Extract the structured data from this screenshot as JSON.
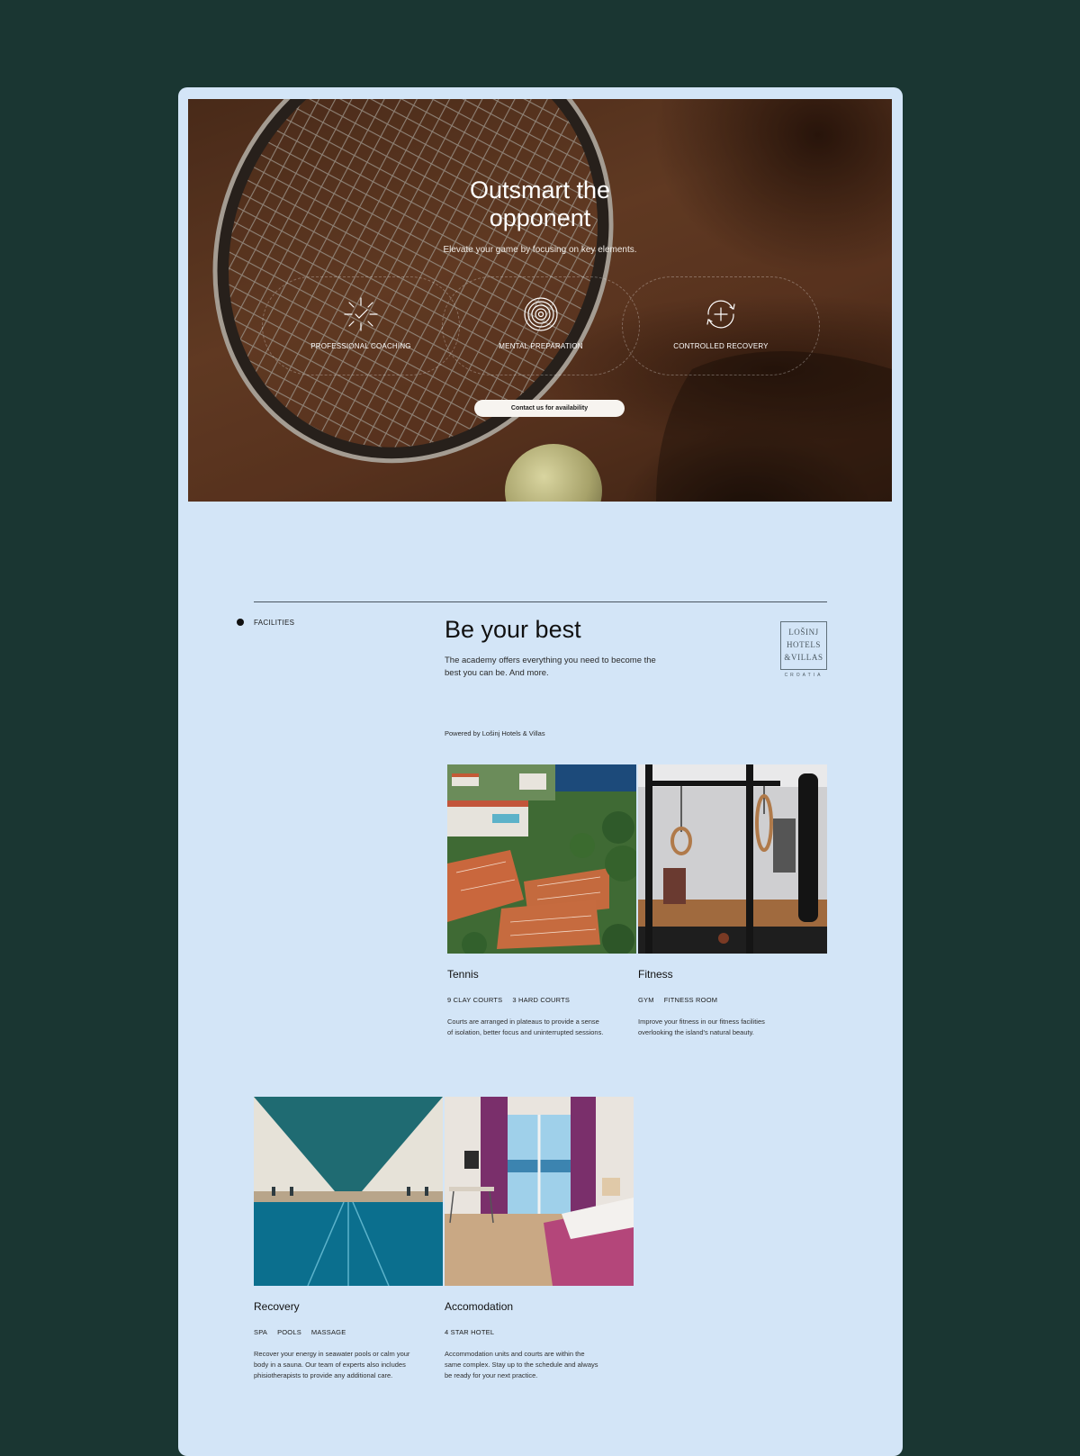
{
  "hero": {
    "title_line1": "Outsmart the",
    "title_line2": "opponent",
    "subtitle": "Elevate your game by focusing on key elements.",
    "features": [
      {
        "label": "PROFESSIONAL COACHING",
        "icon": "sparkle-check-icon"
      },
      {
        "label": "MENTAL PREPARATION",
        "icon": "target-rings-icon"
      },
      {
        "label": "CONTROLLED RECOVERY",
        "icon": "cycle-plus-icon"
      }
    ],
    "cta_label": "Contact us for availability"
  },
  "facilities": {
    "section_label": "FACILITIES",
    "heading": "Be your best",
    "lead": "The academy offers everything you need to become the best you can be. And more.",
    "logo_lines": [
      "LOŠINJ",
      "HOTELS",
      "&VILLAS"
    ],
    "logo_sub": "CROATIA",
    "powered_by": "Powered by Lošinj Hotels & Villas",
    "items": [
      {
        "title": "Tennis",
        "tags": [
          "9 CLAY COURTS",
          "3 HARD COURTS"
        ],
        "desc": "Courts are arranged in plateaus to provide a sense of isolation, better focus and uninterrupted sessions."
      },
      {
        "title": "Fitness",
        "tags": [
          "GYM",
          "FITNESS ROOM"
        ],
        "desc": "Improve your fitness in our fitness facilities overlooking the island's natural beauty."
      },
      {
        "title": "Recovery",
        "tags": [
          "SPA",
          "POOLS",
          "MASSAGE"
        ],
        "desc": "Recover your energy in seawater pools or calm your body in a sauna. Our team of experts also includes phisiotherapists to provide any additional care."
      },
      {
        "title": "Accomodation",
        "tags": [
          "4 STAR HOTEL"
        ],
        "desc": "Accommodation units and courts are within the same complex. Stay up to the schedule and always be ready for your next practice."
      }
    ]
  }
}
